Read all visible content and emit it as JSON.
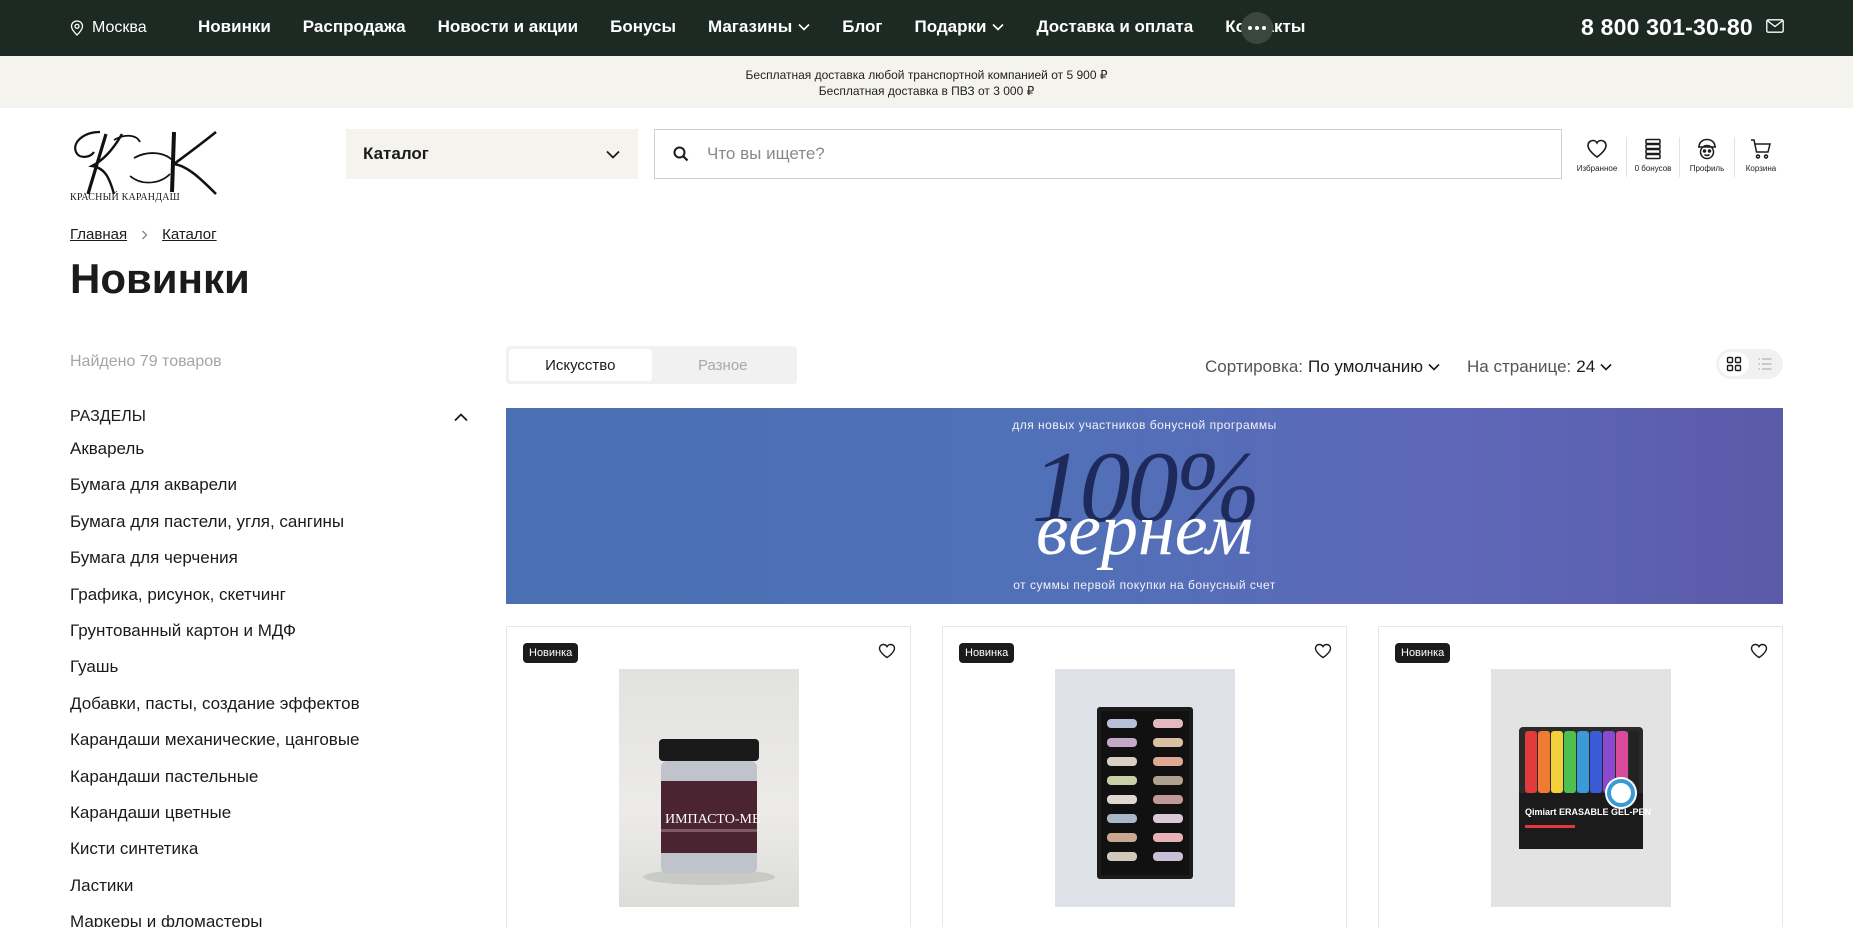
{
  "topbar": {
    "city": "Москва",
    "nav": [
      {
        "label": "Новинки",
        "dropdown": false
      },
      {
        "label": "Распродажа",
        "dropdown": false
      },
      {
        "label": "Новости и акции",
        "dropdown": false
      },
      {
        "label": "Бонусы",
        "dropdown": false
      },
      {
        "label": "Магазины",
        "dropdown": true
      },
      {
        "label": "Блог",
        "dropdown": false
      },
      {
        "label": "Подарки",
        "dropdown": true
      },
      {
        "label": "Доставка и оплата",
        "dropdown": false
      },
      {
        "label": "Контакты",
        "dropdown": false
      }
    ],
    "phone": "8 800 301-30-80"
  },
  "infostrip": {
    "line1": "Бесплатная доставка любой транспортной компанией от 5 900 ₽",
    "line2": "Бесплатная доставка в ПВЗ от 3 000 ₽"
  },
  "header": {
    "logo_text": "Красный Карандаш",
    "catalog_label": "Каталог",
    "search_placeholder": "Что вы ищете?",
    "icons": [
      {
        "label": "Избранное",
        "icon": "heart-icon"
      },
      {
        "label": "0 бонусов",
        "icon": "bonus-coins-icon"
      },
      {
        "label": "Профиль",
        "icon": "profile-icon"
      },
      {
        "label": "Корзина",
        "icon": "cart-icon"
      }
    ]
  },
  "breadcrumb": {
    "home": "Главная",
    "catalog": "Каталог"
  },
  "page": {
    "title": "Новинки"
  },
  "sidebar": {
    "found": "Найдено 79 товаров",
    "section_title": "РАЗДЕЛЫ",
    "items": [
      "Акварель",
      "Бумага для акварели",
      "Бумага для пастели, угля, сангины",
      "Бумага для черчения",
      "Графика, рисунок, скетчинг",
      "Грунтованный картон и МДФ",
      "Гуашь",
      "Добавки, пасты, создание эффектов",
      "Карандаши механические, цанговые",
      "Карандаши пастельные",
      "Карандаши цветные",
      "Кисти синтетика",
      "Ластики",
      "Маркеры и фломастеры"
    ]
  },
  "toolbar": {
    "tabs": [
      "Искусство",
      "Разное"
    ],
    "active_tab": "Искусство",
    "sort_label": "Сортировка:",
    "sort_value": "По умолчанию",
    "perpage_label": "На странице:",
    "perpage_value": "24"
  },
  "banner": {
    "top_text": "для новых участников бонусной программы",
    "big_text": "100%",
    "word": "вернем",
    "bottom_text": "от суммы первой покупки на бонусный счет"
  },
  "products": [
    {
      "badge": "Новинка",
      "image_text": "ИМПАСТО-МЕ"
    },
    {
      "badge": "Новинка",
      "image_text": ""
    },
    {
      "badge": "Новинка",
      "image_text": "Qimiart ERASABLE GEL-PEN"
    }
  ],
  "colors": {
    "topbar_bg": "#1c2a23",
    "strip_bg": "#f4f3ee",
    "banner_blue": "#5170b8"
  }
}
